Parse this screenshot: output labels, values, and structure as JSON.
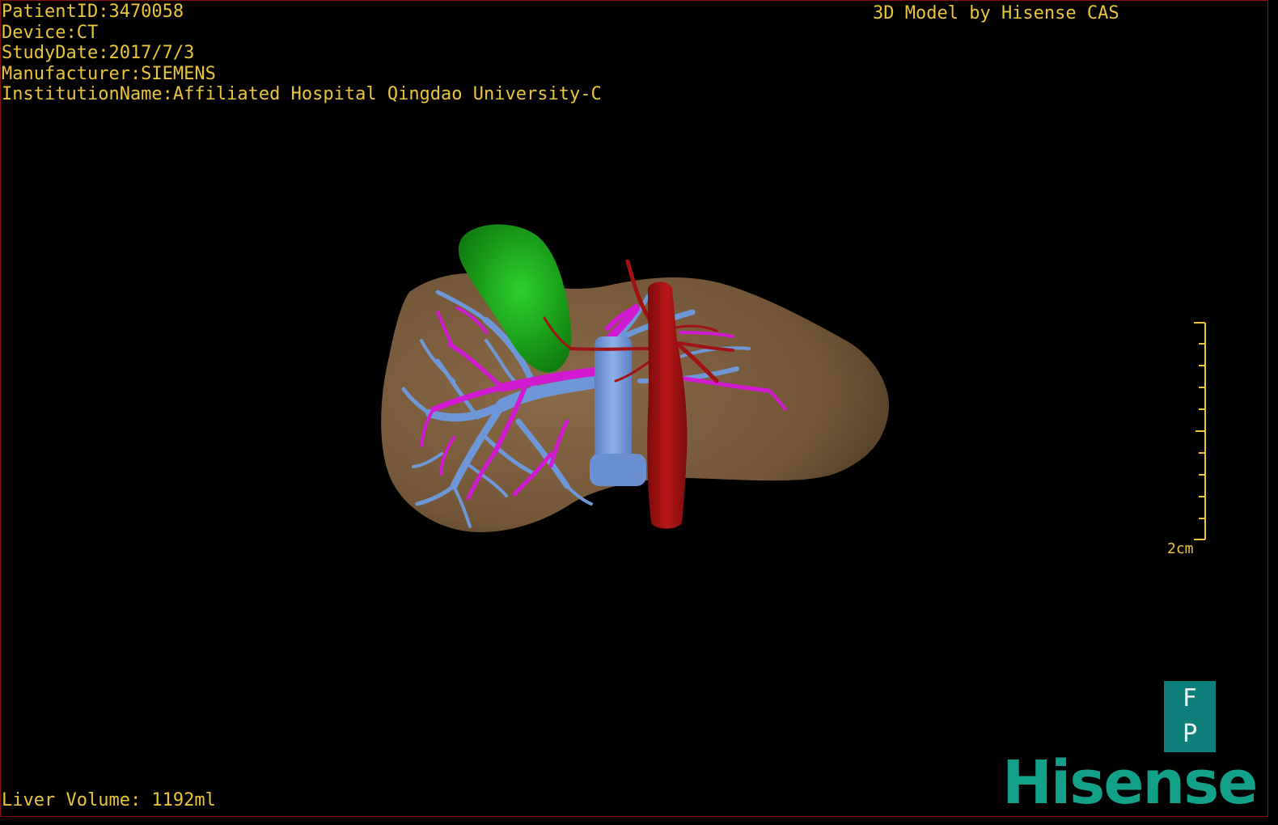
{
  "study_info": {
    "patient_id": "PatientID:3470058",
    "device": "Device:CT",
    "study_date": "StudyDate:2017/7/3",
    "manufacturer": "Manufacturer:SIEMENS",
    "institution": "InstitutionName:Affiliated Hospital Qingdao University-C"
  },
  "credit": "3D Model by Hisense CAS",
  "liver_volume": "Liver Volume: 1192ml",
  "scale": {
    "label": "2cm"
  },
  "orientation": {
    "top": "F",
    "bottom": "P"
  },
  "brand": "Hisense",
  "colors": {
    "text": "#e8c53a",
    "liver": "#7d5f3f",
    "gallbladder": "#17a317",
    "portal_vein": "#6e97d8",
    "hepatic_vein": "#d21ad2",
    "artery": "#a11212",
    "brand": "#12a089"
  }
}
